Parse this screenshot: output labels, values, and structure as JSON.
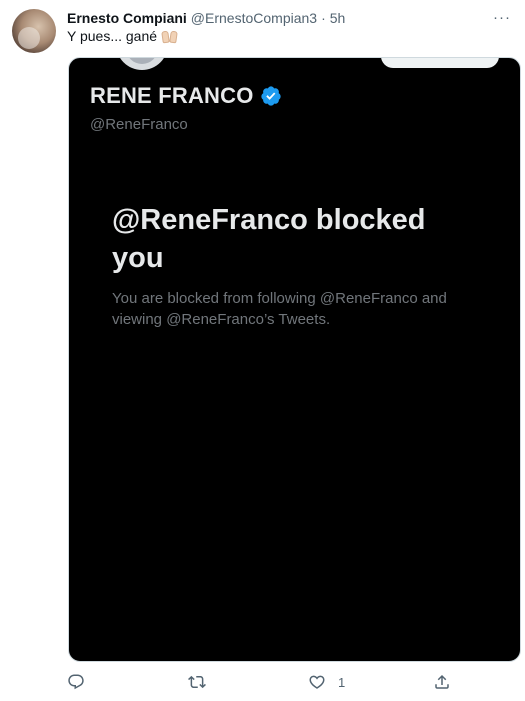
{
  "tweet": {
    "author_name": "Ernesto Compiani",
    "author_handle": "@ErnestoCompian3",
    "separator": "·",
    "time": "5h",
    "text": "Y pues... gané",
    "more_label": "···"
  },
  "screenshot": {
    "profile_name": "RENE FRANCO",
    "profile_handle": "@ReneFranco",
    "blocked_title": "@ReneFranco blocked you",
    "blocked_message": "You are blocked from following @ReneFranco and viewing @ReneFranco’s Tweets."
  },
  "actions": {
    "like_count": "1"
  },
  "colors": {
    "verified_blue": "#1d9bf0",
    "media_background": "#000000",
    "secondary_text": "#536471"
  },
  "icons": [
    "more-icon",
    "raising-hands-emoji",
    "verified-badge-icon",
    "reply-icon",
    "retweet-icon",
    "like-icon",
    "share-icon"
  ]
}
